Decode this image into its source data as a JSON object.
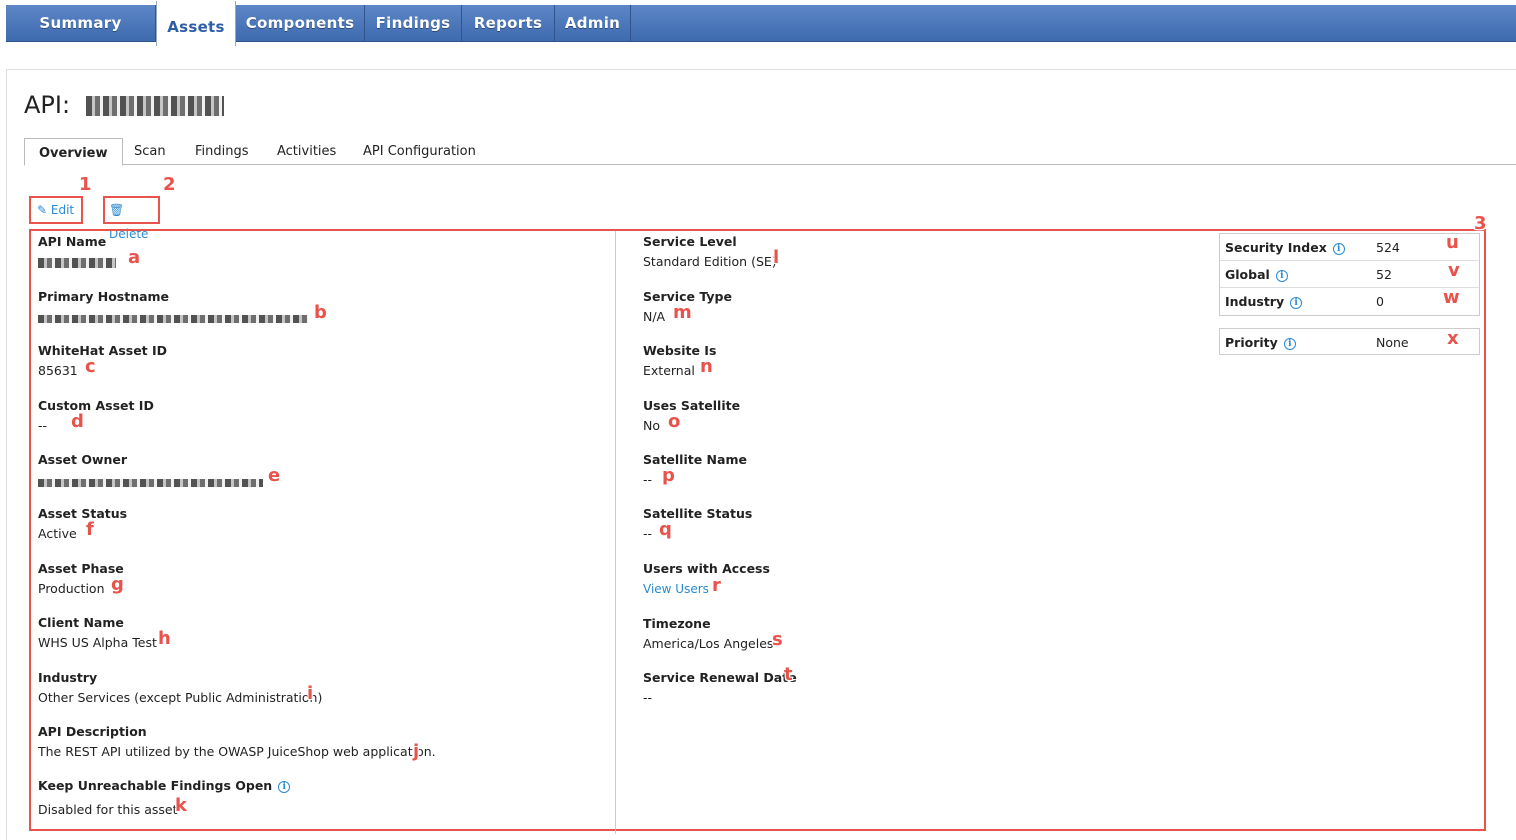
{
  "nav": {
    "tabs": [
      {
        "label": "Summary"
      },
      {
        "label": "Assets"
      },
      {
        "label": "Components"
      },
      {
        "label": "Findings"
      },
      {
        "label": "Reports"
      },
      {
        "label": "Admin"
      }
    ],
    "active": "Assets"
  },
  "page": {
    "title_prefix": "API:"
  },
  "subtabs": [
    {
      "label": "Overview"
    },
    {
      "label": "Scan"
    },
    {
      "label": "Findings"
    },
    {
      "label": "Activities"
    },
    {
      "label": "API Configuration"
    }
  ],
  "actions": {
    "edit_label": "Edit",
    "delete_label": "Delete"
  },
  "markers": {
    "m1": "1",
    "m2": "2",
    "m3": "3",
    "a": "a",
    "b": "b",
    "c": "c",
    "d": "d",
    "e": "e",
    "f": "f",
    "g": "g",
    "h": "h",
    "i": "i",
    "j": "j",
    "k": "k",
    "l": "l",
    "m": "m",
    "n": "n",
    "o": "o",
    "p": "p",
    "q": "q",
    "r": "r",
    "s": "s",
    "t": "t",
    "u": "u",
    "v": "v",
    "w": "w",
    "x": "x"
  },
  "left_fields": {
    "api_name": {
      "label": "API Name"
    },
    "primary_hostname": {
      "label": "Primary Hostname"
    },
    "asset_id": {
      "label": "WhiteHat Asset ID",
      "value": "85631"
    },
    "custom_asset_id": {
      "label": "Custom Asset ID",
      "value": "--"
    },
    "asset_owner": {
      "label": "Asset Owner"
    },
    "asset_status": {
      "label": "Asset Status",
      "value": "Active"
    },
    "asset_phase": {
      "label": "Asset Phase",
      "value": "Production"
    },
    "client_name": {
      "label": "Client Name",
      "value": "WHS US Alpha Test"
    },
    "industry": {
      "label": "Industry",
      "value": "Other Services (except Public Administration)"
    },
    "api_description": {
      "label": "API Description",
      "value": "The REST API utilized by the OWASP JuiceShop web application."
    },
    "keep_unreachable": {
      "label": "Keep Unreachable Findings Open",
      "value": "Disabled for this asset"
    }
  },
  "right_fields": {
    "service_level": {
      "label": "Service Level",
      "value": "Standard Edition (SE)"
    },
    "service_type": {
      "label": "Service Type",
      "value": "N/A"
    },
    "website_is": {
      "label": "Website Is",
      "value": "External"
    },
    "uses_satellite": {
      "label": "Uses Satellite",
      "value": "No"
    },
    "satellite_name": {
      "label": "Satellite Name",
      "value": "--"
    },
    "satellite_status": {
      "label": "Satellite Status",
      "value": "--"
    },
    "users_with_access": {
      "label": "Users with Access",
      "value": "View Users"
    },
    "timezone": {
      "label": "Timezone",
      "value": "America/Los Angeles"
    },
    "service_renewal": {
      "label": "Service Renewal Date",
      "value": "--"
    }
  },
  "scores": {
    "security_index": {
      "label": "Security Index",
      "value": "524"
    },
    "global": {
      "label": "Global",
      "value": "52"
    },
    "industry": {
      "label": "Industry",
      "value": "0"
    },
    "priority": {
      "label": "Priority",
      "value": "None"
    }
  },
  "colors": {
    "nav_blue": "#4a76ba",
    "annotation_red": "#e8534c",
    "link_blue": "#2a8ad4"
  }
}
